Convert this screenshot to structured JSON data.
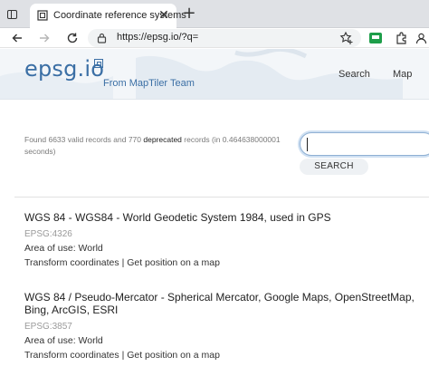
{
  "browser": {
    "tab_title": "Coordinate reference systems",
    "tab_close": "✕",
    "new_tab": "+",
    "url": "https://epsg.io/?q="
  },
  "header": {
    "logo_text": "epsg.io",
    "tagline": "From MapTiler Team",
    "nav": [
      "Search",
      "Map"
    ]
  },
  "search": {
    "found_prefix": "Found 6633 valid records and 770 ",
    "found_deprecated": "deprecated",
    "found_suffix": " records (in 0.464638000001 seconds)",
    "input_value": "",
    "button_label": "SEARCH"
  },
  "results": [
    {
      "title": "WGS 84 - WGS84 - World Geodetic System 1984, used in GPS",
      "code": "EPSG:4326",
      "area": "Area of use: World",
      "link_transform": "Transform coordinates",
      "separator": " | ",
      "link_position": "Get position on a map"
    },
    {
      "title": "WGS 84 / Pseudo-Mercator - Spherical Mercator, Google Maps, OpenStreetMap, Bing, ArcGIS, ESRI",
      "code": "EPSG:3857",
      "area": "Area of use: World",
      "link_transform": "Transform coordinates",
      "separator": " | ",
      "link_position": "Get position on a map"
    }
  ],
  "colors": {
    "brand": "#3b6fa5",
    "chrome": "#dfe1e5",
    "accent_green": "#1e9e4a"
  },
  "icons": {
    "tab_actions": "tab-actions-icon",
    "back": "arrow-left-icon",
    "forward": "arrow-right-icon",
    "refresh": "refresh-icon",
    "home": "home-icon",
    "lock": "lock-icon",
    "favorite": "star-add-icon",
    "extension_green": "extension-green-icon",
    "extension": "puzzle-icon",
    "profile": "profile-icon"
  }
}
